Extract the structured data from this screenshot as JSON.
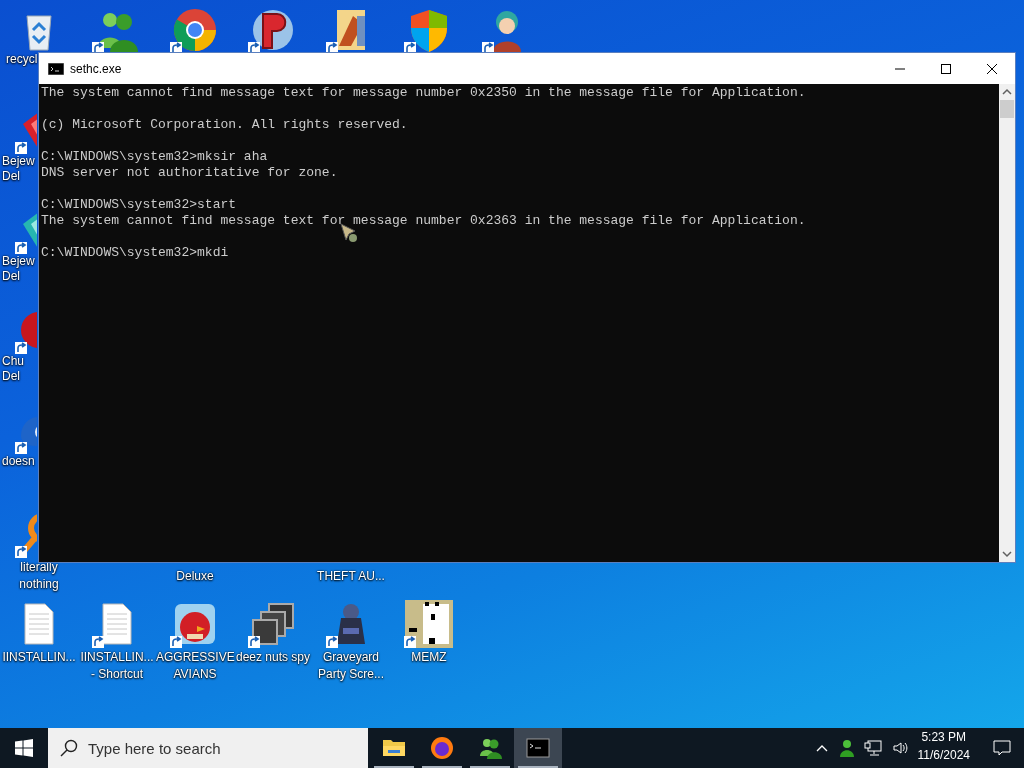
{
  "desktop_icons": [
    {
      "kind": "recycle-bin",
      "shortcut": false,
      "label": [
        "recycl"
      ]
    },
    {
      "kind": "people",
      "shortcut": true
    },
    {
      "kind": "browser",
      "shortcut": true
    },
    {
      "kind": "logo",
      "shortcut": true
    },
    {
      "kind": "folder-document",
      "shortcut": true
    },
    {
      "kind": "shield",
      "shortcut": true
    },
    {
      "kind": "character",
      "shortcut": true
    },
    {
      "kind": "gem-red",
      "shortcut": true,
      "label": [
        "Bejew",
        "Del"
      ]
    },
    {
      "kind": "gem-teal",
      "shortcut": true,
      "label": [
        "Bejew",
        "Del"
      ]
    },
    {
      "kind": "creature",
      "shortcut": true,
      "label": [
        "Chu",
        "Del"
      ]
    },
    {
      "kind": "bird-blue",
      "shortcut": true,
      "label": [
        "doesn"
      ]
    },
    {
      "kind": "ring",
      "shortcut": true,
      "label": [
        "literally",
        "nothing"
      ]
    },
    {
      "kind": "label-only",
      "label": [
        "Deluxe"
      ]
    },
    {
      "kind": "label-only",
      "label": [
        "THEFT AU..."
      ]
    },
    {
      "kind": "document",
      "shortcut": false,
      "label": [
        "IINSTALLIN..."
      ]
    },
    {
      "kind": "document",
      "shortcut": true,
      "label": [
        "IINSTALLIN...",
        "- Shortcut"
      ]
    },
    {
      "kind": "angry-bird",
      "shortcut": true,
      "label": [
        "AGGRESSIVE",
        "AVIANS"
      ]
    },
    {
      "kind": "windows-stack",
      "shortcut": true,
      "label": [
        "deez nuts spy"
      ]
    },
    {
      "kind": "statue",
      "shortcut": true,
      "label": [
        "Graveyard",
        "Party Scre..."
      ]
    },
    {
      "kind": "pixel-art",
      "shortcut": true,
      "label": [
        "MEMZ"
      ]
    }
  ],
  "window": {
    "title": "sethc.exe",
    "console_blocks": [
      [
        "The system cannot find message text for message number 0x2350 in the message file for Application."
      ],
      [
        "(c) Microsoft Corporation. All rights reserved."
      ],
      [
        "C:\\WINDOWS\\system32>mksir aha",
        "DNS server not authoritative for zone."
      ],
      [
        "C:\\WINDOWS\\system32>start",
        "The system cannot find message text for message number 0x2363 in the message file for Application."
      ],
      [
        "C:\\WINDOWS\\system32>mkdi"
      ]
    ]
  },
  "taskbar": {
    "search": {
      "placeholder": "Type here to search"
    },
    "apps": [
      {
        "kind": "folder",
        "running": true,
        "selected": false
      },
      {
        "kind": "browser",
        "running": true,
        "selected": false
      },
      {
        "kind": "people",
        "running": true,
        "selected": false
      },
      {
        "kind": "console",
        "running": true,
        "selected": true
      }
    ],
    "clock": {
      "time": "5:23 PM",
      "date": "11/6/2024"
    }
  }
}
